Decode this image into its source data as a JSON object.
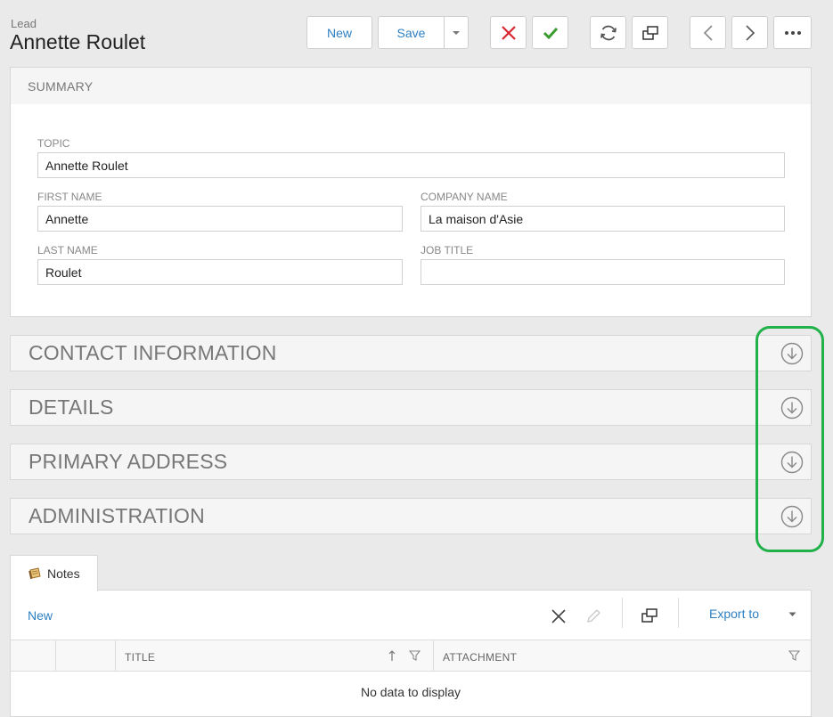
{
  "header": {
    "entity_type": "Lead",
    "title": "Annette Roulet"
  },
  "toolbar": {
    "new_label": "New",
    "save_label": "Save"
  },
  "summary": {
    "heading": "SUMMARY",
    "fields": {
      "topic": {
        "label": "TOPIC",
        "value": "Annette Roulet"
      },
      "first_name": {
        "label": "FIRST NAME",
        "value": "Annette"
      },
      "company_name": {
        "label": "COMPANY NAME",
        "value": "La maison d'Asie"
      },
      "last_name": {
        "label": "LAST NAME",
        "value": "Roulet"
      },
      "job_title": {
        "label": "JOB TITLE",
        "value": ""
      }
    }
  },
  "sections": [
    {
      "title": "CONTACT INFORMATION"
    },
    {
      "title": "DETAILS"
    },
    {
      "title": "PRIMARY ADDRESS"
    },
    {
      "title": "ADMINISTRATION"
    }
  ],
  "notes": {
    "tab_label": "Notes",
    "new_label": "New",
    "export_label": "Export to",
    "columns": [
      "TITLE",
      "ATTACHMENT"
    ],
    "empty_text": "No data to display"
  },
  "colors": {
    "accent": "#2d7fc1",
    "highlight": "#20b14a",
    "delete": "#d9262f",
    "approve": "#3a9b2e"
  }
}
